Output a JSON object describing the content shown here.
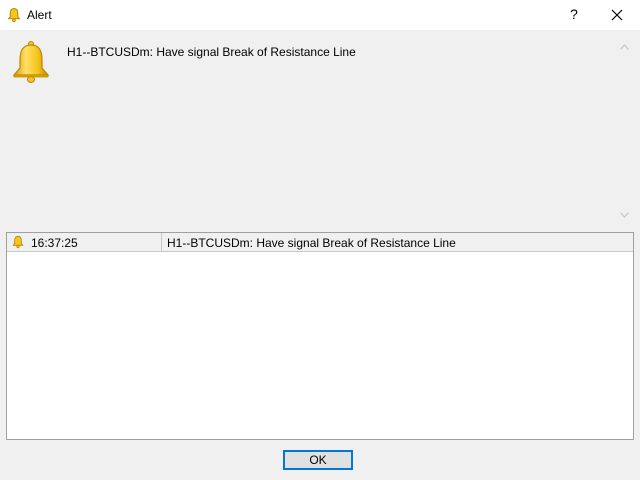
{
  "window": {
    "title": "Alert",
    "help_label": "?",
    "icon": "bell-icon"
  },
  "message": {
    "text": "H1--BTCUSDm: Have signal Break of Resistance Line",
    "icon": "bell-icon"
  },
  "log": {
    "rows": [
      {
        "icon": "bell-icon",
        "time": "16:37:25",
        "message": "H1--BTCUSDm: Have signal Break of Resistance Line"
      }
    ]
  },
  "buttons": {
    "ok_label": "OK"
  },
  "colors": {
    "bell_fill": "#f5c518",
    "bell_outline": "#b8860b",
    "focus_border": "#0078d7",
    "background": "#f0f0f0"
  }
}
